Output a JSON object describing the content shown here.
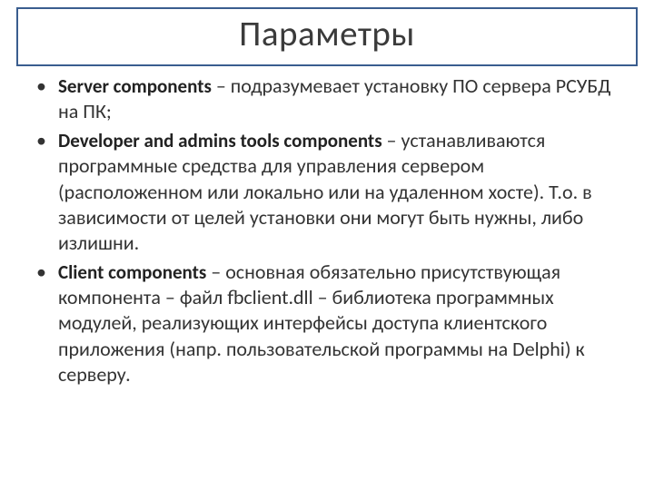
{
  "title": "Параметры",
  "bullets": [
    {
      "bold": "Server components",
      "rest": " – подразумевает установку ПО сервера РСУБД на ПК;"
    },
    {
      "bold": "Developer and admins tools components",
      "rest": " – устанавливаются программные средства для управления сервером (расположенном или локально или на удаленном хосте). Т.о. в зависимости от целей установки они могут быть нужны, либо излишни."
    },
    {
      "bold": "Client components",
      "rest": " – основная обязательно присутствующая компонента – файл fbclient.dll – библиотека программных модулей, реализующих интерфейсы доступа клиентского приложения (напр. пользовательской программы на Delphi) к серверу."
    }
  ]
}
